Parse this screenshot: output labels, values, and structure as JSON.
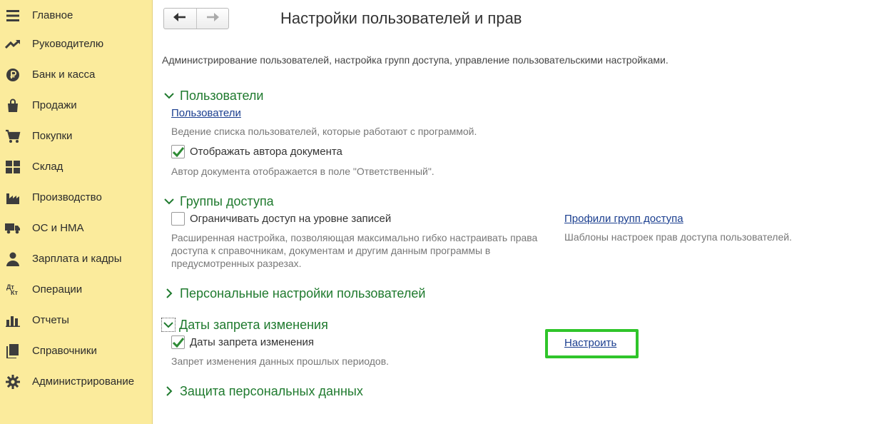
{
  "sidebar": {
    "items": [
      {
        "label": "Главное",
        "icon": "menu-lines-icon"
      },
      {
        "label": "Руководителю",
        "icon": "trend-up-icon"
      },
      {
        "label": "Банк и касса",
        "icon": "ruble-coin-icon"
      },
      {
        "label": "Продажи",
        "icon": "shopping-bag-icon"
      },
      {
        "label": "Покупки",
        "icon": "cart-icon"
      },
      {
        "label": "Склад",
        "icon": "warehouse-grid-icon"
      },
      {
        "label": "Производство",
        "icon": "factory-icon"
      },
      {
        "label": "ОС и НМА",
        "icon": "truck-icon"
      },
      {
        "label": "Зарплата и кадры",
        "icon": "person-icon"
      },
      {
        "label": "Операции",
        "icon": "debit-credit-icon",
        "icon_text_top": "Дт",
        "icon_text_bottom": "Кт"
      },
      {
        "label": "Отчеты",
        "icon": "bar-chart-icon"
      },
      {
        "label": "Справочники",
        "icon": "books-icon"
      },
      {
        "label": "Администрирование",
        "icon": "gear-icon"
      }
    ]
  },
  "header": {
    "title": "Настройки пользователей и прав",
    "description": "Администрирование пользователей, настройка групп доступа, управление пользовательскими настройками."
  },
  "sections": {
    "users": {
      "title": "Пользователи",
      "expanded": true,
      "link": "Пользователи",
      "link_hint": "Ведение списка пользователей, которые работают с программой.",
      "checkbox_label": "Отображать автора документа",
      "checkbox_checked": true,
      "checkbox_hint": "Автор документа отображается в поле \"Ответственный\"."
    },
    "access_groups": {
      "title": "Группы доступа",
      "expanded": true,
      "checkbox_label": "Ограничивать доступ на уровне записей",
      "checkbox_checked": false,
      "checkbox_hint": "Расширенная настройка, позволяющая максимально гибко настраивать права доступа к справочникам, документам и другим данным программы в предусмотренных разрезах.",
      "link": "Профили групп доступа",
      "link_hint": "Шаблоны настроек прав доступа пользователей."
    },
    "personal_settings": {
      "title": "Персональные настройки пользователей",
      "expanded": false
    },
    "change_ban_dates": {
      "title": "Даты запрета изменения",
      "expanded": true,
      "checkbox_label": "Даты запрета изменения",
      "checkbox_checked": true,
      "checkbox_hint": "Запрет изменения данных прошлых периодов.",
      "link": "Настроить"
    },
    "personal_data": {
      "title": "Защита персональных данных",
      "expanded": false
    }
  },
  "colors": {
    "sidebar_bg": "#fbeb9c",
    "section_title": "#1f7a2e",
    "link": "#1a3e8f",
    "highlight": "#2fc52a",
    "check_mark": "#2e8b35"
  }
}
